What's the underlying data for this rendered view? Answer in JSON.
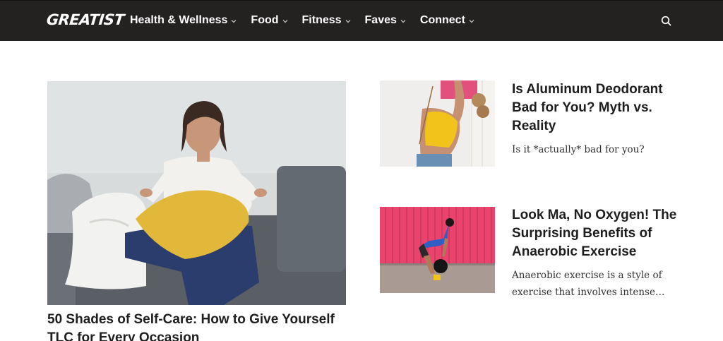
{
  "site": {
    "logo_text": "GREATIST"
  },
  "nav": {
    "items": [
      {
        "label": "Health & Wellness"
      },
      {
        "label": "Food"
      },
      {
        "label": "Fitness"
      },
      {
        "label": "Faves"
      },
      {
        "label": "Connect"
      }
    ],
    "search_icon": "search-icon",
    "dropdown_icon": "chevron-down-icon"
  },
  "featured": {
    "title": "50 Shades of Self-Care: How to Give Yourself TLC for Every Occasion",
    "image_icon": "photo-woman-on-couch"
  },
  "cards": [
    {
      "title": "Is Aluminum Deodorant Bad for You? Myth vs. Reality",
      "description": "Is it *actually* bad for you?",
      "image_icon": "photo-woman-yellow-top"
    },
    {
      "title": "Look Ma, No Oxygen! The Surprising Benefits of Anaerobic Exercise",
      "description": "Anaerobic exercise is a style of exercise that involves intense…",
      "image_icon": "photo-woman-kettlebell"
    }
  ],
  "colors": {
    "nav_bg": "#242121",
    "nav_text": "#ffffff",
    "title_text": "#1e1e1e",
    "pink_wall": "#e8446d"
  }
}
